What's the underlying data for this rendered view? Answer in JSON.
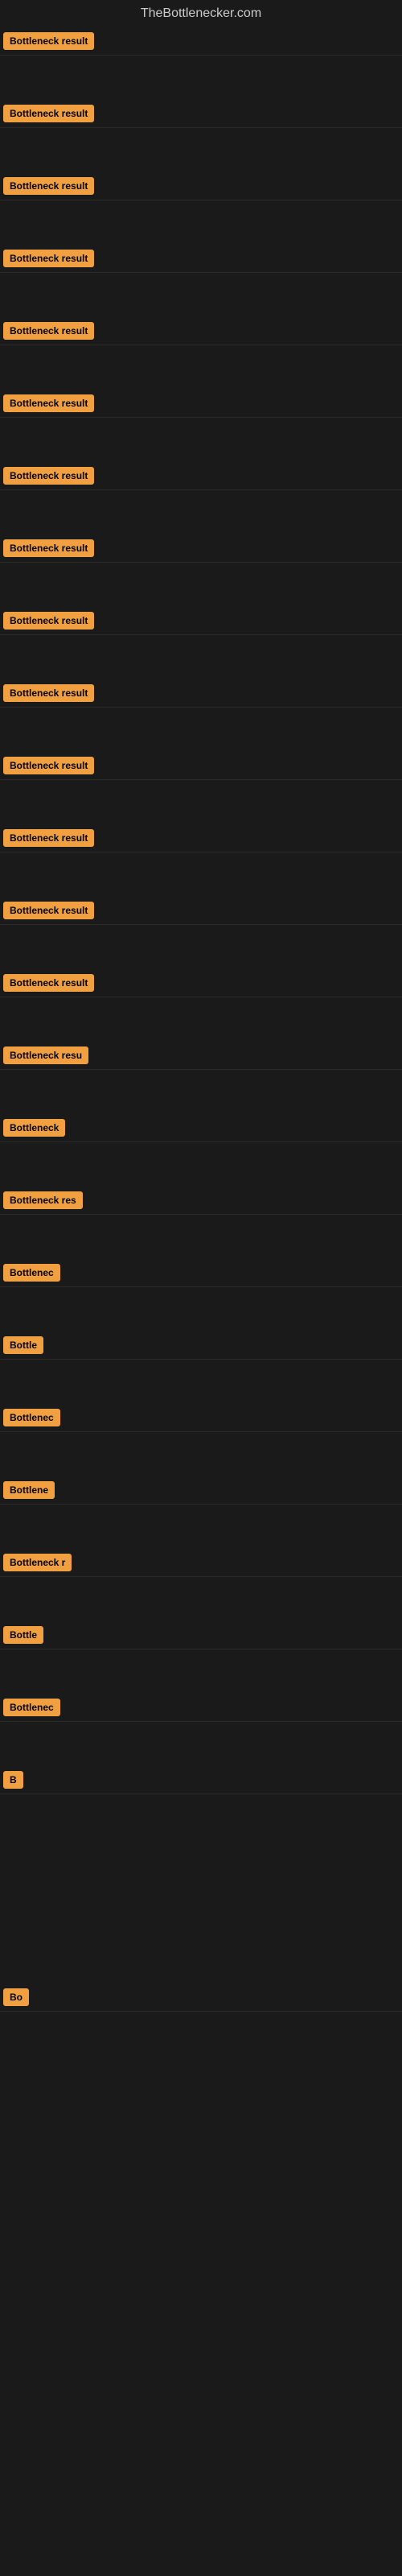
{
  "header": {
    "title": "TheBottlenecker.com"
  },
  "items": [
    {
      "id": 1,
      "label": "Bottleneck result",
      "widthClass": "badge-full",
      "gap_after": true
    },
    {
      "id": 2,
      "label": "Bottleneck result",
      "widthClass": "badge-full",
      "gap_after": true
    },
    {
      "id": 3,
      "label": "Bottleneck result",
      "widthClass": "badge-full",
      "gap_after": true
    },
    {
      "id": 4,
      "label": "Bottleneck result",
      "widthClass": "badge-full",
      "gap_after": true
    },
    {
      "id": 5,
      "label": "Bottleneck result",
      "widthClass": "badge-full",
      "gap_after": true
    },
    {
      "id": 6,
      "label": "Bottleneck result",
      "widthClass": "badge-full",
      "gap_after": true
    },
    {
      "id": 7,
      "label": "Bottleneck result",
      "widthClass": "badge-full",
      "gap_after": true
    },
    {
      "id": 8,
      "label": "Bottleneck result",
      "widthClass": "badge-full",
      "gap_after": true
    },
    {
      "id": 9,
      "label": "Bottleneck result",
      "widthClass": "badge-full",
      "gap_after": true
    },
    {
      "id": 10,
      "label": "Bottleneck result",
      "widthClass": "badge-full",
      "gap_after": true
    },
    {
      "id": 11,
      "label": "Bottleneck result",
      "widthClass": "badge-full",
      "gap_after": true
    },
    {
      "id": 12,
      "label": "Bottleneck result",
      "widthClass": "badge-full",
      "gap_after": true
    },
    {
      "id": 13,
      "label": "Bottleneck result",
      "widthClass": "badge-full",
      "gap_after": true
    },
    {
      "id": 14,
      "label": "Bottleneck result",
      "widthClass": "badge-full",
      "gap_after": true
    },
    {
      "id": 15,
      "label": "Bottleneck resu",
      "widthClass": "badge-w1",
      "gap_after": true
    },
    {
      "id": 16,
      "label": "Bottleneck",
      "widthClass": "badge-w4",
      "gap_after": true
    },
    {
      "id": 17,
      "label": "Bottleneck res",
      "widthClass": "badge-w2",
      "gap_after": true
    },
    {
      "id": 18,
      "label": "Bottlenec",
      "widthClass": "badge-w5",
      "gap_after": true
    },
    {
      "id": 19,
      "label": "Bottle",
      "widthClass": "badge-w7",
      "gap_after": true
    },
    {
      "id": 20,
      "label": "Bottlenec",
      "widthClass": "badge-w5",
      "gap_after": true
    },
    {
      "id": 21,
      "label": "Bottlene",
      "widthClass": "badge-w6",
      "gap_after": true
    },
    {
      "id": 22,
      "label": "Bottleneck r",
      "widthClass": "badge-w3",
      "gap_after": true
    },
    {
      "id": 23,
      "label": "Bottle",
      "widthClass": "badge-w7",
      "gap_after": true
    },
    {
      "id": 24,
      "label": "Bottlenec",
      "widthClass": "badge-w5",
      "gap_after": true
    },
    {
      "id": 25,
      "label": "B",
      "widthClass": "badge-w11",
      "gap_after": true
    }
  ],
  "gap_sections": [
    {
      "id": "gap1",
      "size": "large"
    },
    {
      "id": "gap2",
      "size": "large"
    },
    {
      "id": "gap3",
      "size": "normal"
    }
  ],
  "final_item": {
    "label": "Bo",
    "widthClass": "badge-w10"
  }
}
